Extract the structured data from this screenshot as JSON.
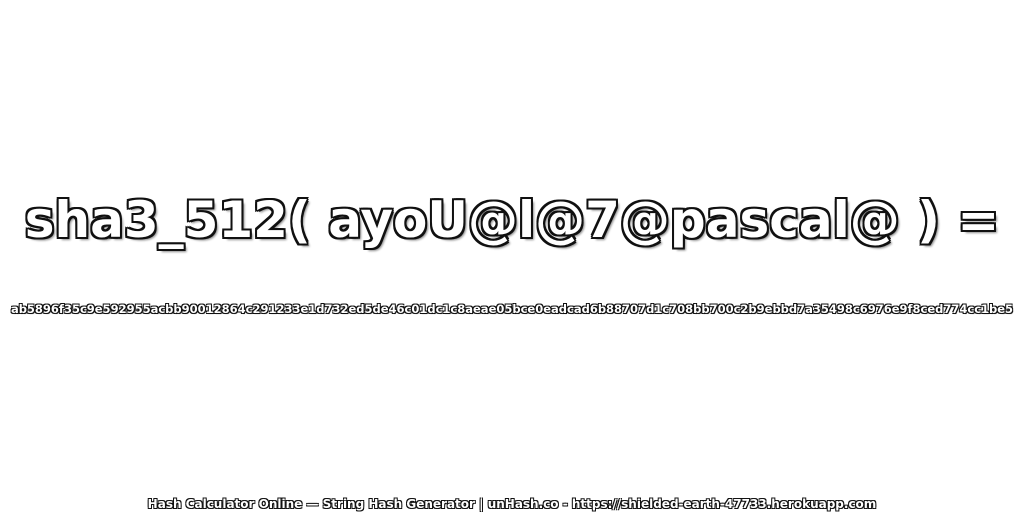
{
  "main": {
    "expression": "sha3_512( ayoU@l@7@pascal@ ) =",
    "hash_value": "ab5896f35c9e592955acbb90012864c291233e1d732ed5de46c01dc1c8aeae05bce0eadcad6b88707d1c708bb700c2b9ebbd7a35498c6976e9f8ced774cc1be5"
  },
  "footer": {
    "text": "Hash Calculator Online — String Hash Generator | unHash.co - https://shielded-earth-47733.herokuapp.com"
  },
  "colors": {
    "background": "#ffffff",
    "text_fill": "#ffffff",
    "text_outline": "#111111"
  }
}
